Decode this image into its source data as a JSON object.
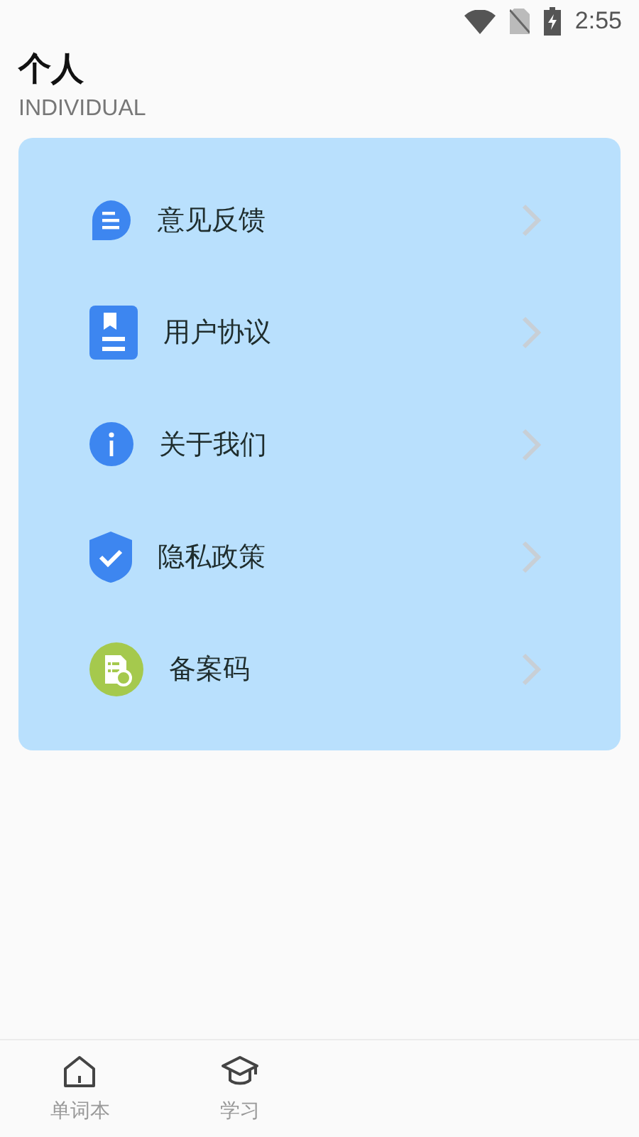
{
  "status_bar": {
    "time": "2:55"
  },
  "header": {
    "title": "个人",
    "subtitle": "INDIVIDUAL"
  },
  "menu": [
    {
      "label": "意见反馈",
      "kind": "feedback"
    },
    {
      "label": "用户协议",
      "kind": "agreement"
    },
    {
      "label": "关于我们",
      "kind": "about"
    },
    {
      "label": "隐私政策",
      "kind": "privacy"
    },
    {
      "label": "备案码",
      "kind": "record"
    }
  ],
  "tabs": [
    {
      "label": "单词本",
      "kind": "home",
      "selected": false
    },
    {
      "label": "学习",
      "kind": "study",
      "selected": false
    }
  ]
}
